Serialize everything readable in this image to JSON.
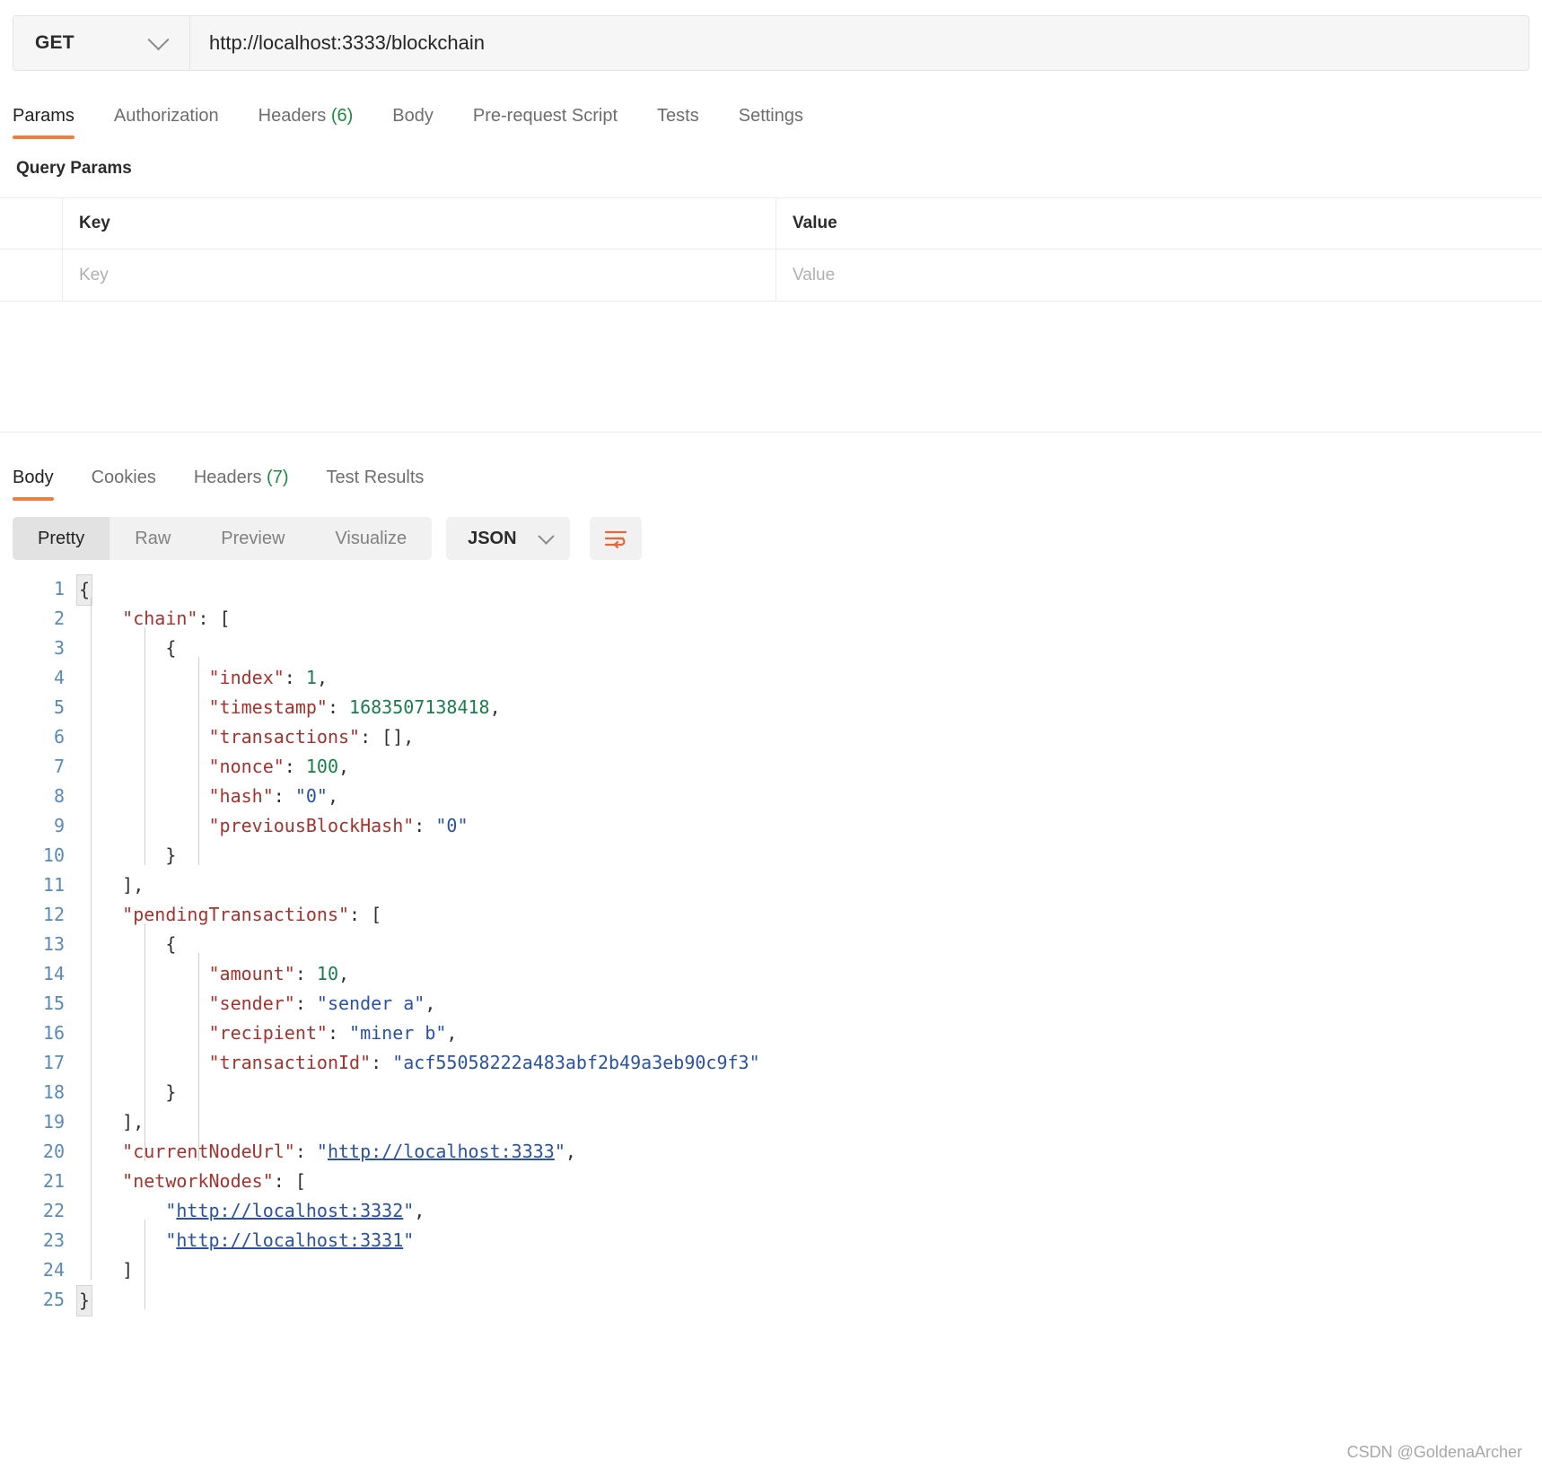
{
  "request": {
    "method": "GET",
    "url": "http://localhost:3333/blockchain",
    "tabs": [
      {
        "label": "Params",
        "active": true
      },
      {
        "label": "Authorization",
        "active": false
      },
      {
        "label": "Headers",
        "count": "(6)",
        "active": false
      },
      {
        "label": "Body",
        "active": false
      },
      {
        "label": "Pre-request Script",
        "active": false
      },
      {
        "label": "Tests",
        "active": false
      },
      {
        "label": "Settings",
        "active": false
      }
    ],
    "query_params": {
      "section_title": "Query Params",
      "headers": {
        "key": "Key",
        "value": "Value"
      },
      "placeholder_row": {
        "key": "Key",
        "value": "Value"
      }
    }
  },
  "response": {
    "tabs": [
      {
        "label": "Body",
        "active": true
      },
      {
        "label": "Cookies",
        "active": false
      },
      {
        "label": "Headers",
        "count": "(7)",
        "active": false
      },
      {
        "label": "Test Results",
        "active": false
      }
    ],
    "view_modes": [
      {
        "label": "Pretty",
        "active": true
      },
      {
        "label": "Raw",
        "active": false
      },
      {
        "label": "Preview",
        "active": false
      },
      {
        "label": "Visualize",
        "active": false
      }
    ],
    "format": "JSON",
    "wrap_icon": "wrap-lines-icon"
  },
  "body_json": {
    "line_numbers": [
      1,
      2,
      3,
      4,
      5,
      6,
      7,
      8,
      9,
      10,
      11,
      12,
      13,
      14,
      15,
      16,
      17,
      18,
      19,
      20,
      21,
      22,
      23,
      24,
      25
    ],
    "lines": [
      "{",
      "    \"chain\": [",
      "        {",
      "            \"index\": 1,",
      "            \"timestamp\": 1683507138418,",
      "            \"transactions\": [],",
      "            \"nonce\": 100,",
      "            \"hash\": \"0\",",
      "            \"previousBlockHash\": \"0\"",
      "        }",
      "    ],",
      "    \"pendingTransactions\": [",
      "        {",
      "            \"amount\": 10,",
      "            \"sender\": \"sender a\",",
      "            \"recipient\": \"miner b\",",
      "            \"transactionId\": \"acf55058222a483abf2b49a3eb90c9f3\"",
      "        }",
      "    ],",
      "    \"currentNodeUrl\": \"http://localhost:3333\",",
      "    \"networkNodes\": [",
      "        \"http://localhost:3332\",",
      "        \"http://localhost:3331\"",
      "    ]",
      "}"
    ],
    "values": {
      "chain": [
        {
          "index": 1,
          "timestamp": 1683507138418,
          "transactions": [],
          "nonce": 100,
          "hash": "0",
          "previousBlockHash": "0"
        }
      ],
      "pendingTransactions": [
        {
          "amount": 10,
          "sender": "sender a",
          "recipient": "miner b",
          "transactionId": "acf55058222a483abf2b49a3eb90c9f3"
        }
      ],
      "currentNodeUrl": "http://localhost:3333",
      "networkNodes": [
        "http://localhost:3332",
        "http://localhost:3331"
      ]
    }
  },
  "watermark": "CSDN @GoldenaArcher",
  "colors": {
    "accent": "#ef7d41",
    "key": "#a3332e",
    "string": "#2a52a0",
    "number": "#1a7d4a",
    "count": "#1d8a3f",
    "linenum": "#5a8ab5"
  }
}
